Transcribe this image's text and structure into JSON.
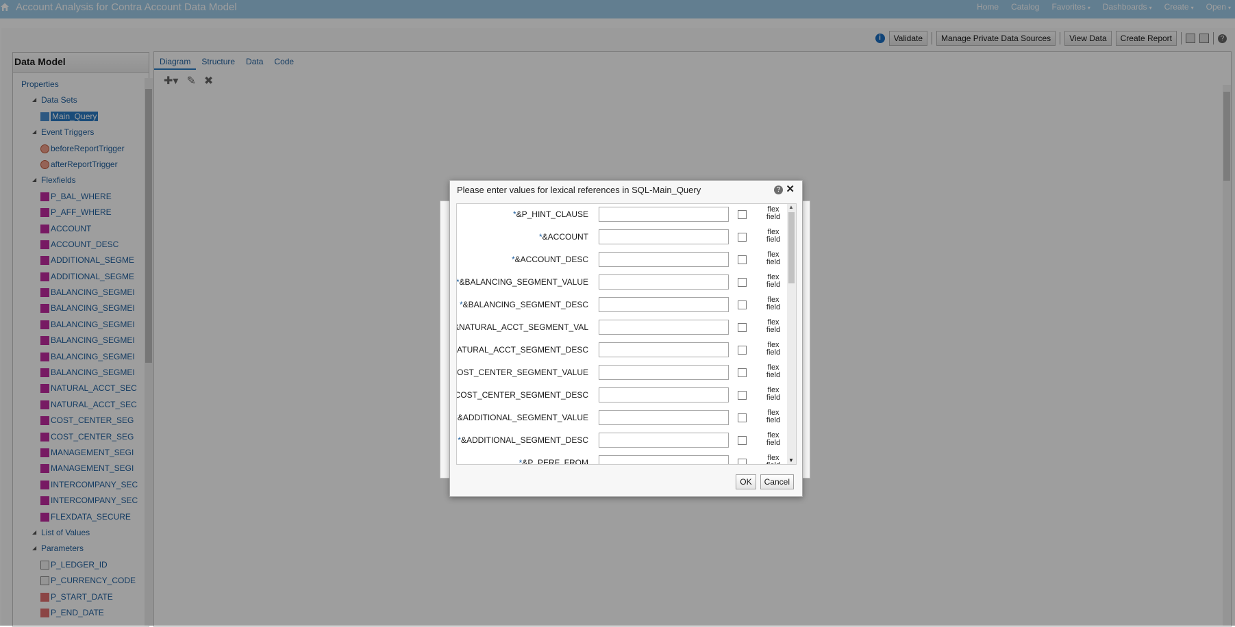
{
  "app": {
    "title": "Account Analysis for Contra Account Data Model",
    "nav": [
      {
        "label": "Home",
        "caret": false
      },
      {
        "label": "Catalog",
        "caret": false
      },
      {
        "label": "Favorites",
        "caret": true
      },
      {
        "label": "Dashboards",
        "caret": true
      },
      {
        "label": "Create",
        "caret": true
      },
      {
        "label": "Open",
        "caret": true
      }
    ]
  },
  "toolbar": {
    "validate": "Validate",
    "manage_sources": "Manage Private Data Sources",
    "view_data": "View Data",
    "create_report": "Create Report"
  },
  "data_model": {
    "header": "Data Model",
    "tree": [
      {
        "label": "Properties",
        "level": 0,
        "icon": "",
        "arrow": false,
        "selected": false
      },
      {
        "label": "Data Sets",
        "level": 1,
        "icon": "",
        "arrow": true,
        "selected": false
      },
      {
        "label": "Main_Query",
        "level": 2,
        "icon": "dataset-icon",
        "arrow": false,
        "selected": true
      },
      {
        "label": "Event Triggers",
        "level": 1,
        "icon": "",
        "arrow": true,
        "selected": false
      },
      {
        "label": "beforeReportTrigger",
        "level": 2,
        "icon": "trigger-icon",
        "arrow": false,
        "selected": false
      },
      {
        "label": "afterReportTrigger",
        "level": 2,
        "icon": "trigger-icon",
        "arrow": false,
        "selected": false
      },
      {
        "label": "Flexfields",
        "level": 1,
        "icon": "",
        "arrow": true,
        "selected": false
      },
      {
        "label": "P_BAL_WHERE",
        "level": 2,
        "icon": "flexfield-icon",
        "arrow": false,
        "selected": false
      },
      {
        "label": "P_AFF_WHERE",
        "level": 2,
        "icon": "flexfield-icon",
        "arrow": false,
        "selected": false
      },
      {
        "label": "ACCOUNT",
        "level": 2,
        "icon": "flexfield-icon",
        "arrow": false,
        "selected": false
      },
      {
        "label": "ACCOUNT_DESC",
        "level": 2,
        "icon": "flexfield-icon",
        "arrow": false,
        "selected": false
      },
      {
        "label": "ADDITIONAL_SEGME",
        "level": 2,
        "icon": "flexfield-icon",
        "arrow": false,
        "selected": false
      },
      {
        "label": "ADDITIONAL_SEGME",
        "level": 2,
        "icon": "flexfield-icon",
        "arrow": false,
        "selected": false
      },
      {
        "label": "BALANCING_SEGMEI",
        "level": 2,
        "icon": "flexfield-icon",
        "arrow": false,
        "selected": false
      },
      {
        "label": "BALANCING_SEGMEI",
        "level": 2,
        "icon": "flexfield-icon",
        "arrow": false,
        "selected": false
      },
      {
        "label": "BALANCING_SEGMEI",
        "level": 2,
        "icon": "flexfield-icon",
        "arrow": false,
        "selected": false
      },
      {
        "label": "BALANCING_SEGMEI",
        "level": 2,
        "icon": "flexfield-icon",
        "arrow": false,
        "selected": false
      },
      {
        "label": "BALANCING_SEGMEI",
        "level": 2,
        "icon": "flexfield-icon",
        "arrow": false,
        "selected": false
      },
      {
        "label": "BALANCING_SEGMEI",
        "level": 2,
        "icon": "flexfield-icon",
        "arrow": false,
        "selected": false
      },
      {
        "label": "NATURAL_ACCT_SEC",
        "level": 2,
        "icon": "flexfield-icon",
        "arrow": false,
        "selected": false
      },
      {
        "label": "NATURAL_ACCT_SEC",
        "level": 2,
        "icon": "flexfield-icon",
        "arrow": false,
        "selected": false
      },
      {
        "label": "COST_CENTER_SEG",
        "level": 2,
        "icon": "flexfield-icon",
        "arrow": false,
        "selected": false
      },
      {
        "label": "COST_CENTER_SEG",
        "level": 2,
        "icon": "flexfield-icon",
        "arrow": false,
        "selected": false
      },
      {
        "label": "MANAGEMENT_SEGI",
        "level": 2,
        "icon": "flexfield-icon",
        "arrow": false,
        "selected": false
      },
      {
        "label": "MANAGEMENT_SEGI",
        "level": 2,
        "icon": "flexfield-icon",
        "arrow": false,
        "selected": false
      },
      {
        "label": "INTERCOMPANY_SEC",
        "level": 2,
        "icon": "flexfield-icon",
        "arrow": false,
        "selected": false
      },
      {
        "label": "INTERCOMPANY_SEC",
        "level": 2,
        "icon": "flexfield-icon",
        "arrow": false,
        "selected": false
      },
      {
        "label": "FLEXDATA_SECURE",
        "level": 2,
        "icon": "flexfield-icon",
        "arrow": false,
        "selected": false
      },
      {
        "label": "List of Values",
        "level": 1,
        "icon": "",
        "arrow": true,
        "selected": false
      },
      {
        "label": "Parameters",
        "level": 1,
        "icon": "",
        "arrow": true,
        "selected": false
      },
      {
        "label": "P_LEDGER_ID",
        "level": 2,
        "icon": "parameter-icon",
        "arrow": false,
        "selected": false
      },
      {
        "label": "P_CURRENCY_CODE",
        "level": 2,
        "icon": "parameter-icon",
        "arrow": false,
        "selected": false
      },
      {
        "label": "P_START_DATE",
        "level": 2,
        "icon": "date-parameter-icon",
        "arrow": false,
        "selected": false
      },
      {
        "label": "P_END_DATE",
        "level": 2,
        "icon": "date-parameter-icon",
        "arrow": false,
        "selected": false
      }
    ]
  },
  "tabs": [
    {
      "label": "Diagram",
      "active": true
    },
    {
      "label": "Structure",
      "active": false
    },
    {
      "label": "Data",
      "active": false
    },
    {
      "label": "Code",
      "active": false
    }
  ],
  "dialog": {
    "title": "Please enter values for lexical references in SQL-Main_Query",
    "flex_label_line1": "flex",
    "flex_label_line2": "field",
    "params": [
      {
        "label": "&P_HINT_CLAUSE",
        "value": ""
      },
      {
        "label": "&ACCOUNT",
        "value": ""
      },
      {
        "label": "&ACCOUNT_DESC",
        "value": ""
      },
      {
        "label": "&BALANCING_SEGMENT_VALUE",
        "value": ""
      },
      {
        "label": "&BALANCING_SEGMENT_DESC",
        "value": ""
      },
      {
        "label": "&NATURAL_ACCT_SEGMENT_VAL",
        "value": ""
      },
      {
        "label": "&NATURAL_ACCT_SEGMENT_DESC",
        "value": ""
      },
      {
        "label": "&COST_CENTER_SEGMENT_VALUE",
        "value": ""
      },
      {
        "label": "&COST_CENTER_SEGMENT_DESC",
        "value": ""
      },
      {
        "label": "&ADDITIONAL_SEGMENT_VALUE",
        "value": ""
      },
      {
        "label": "&ADDITIONAL_SEGMENT_DESC",
        "value": ""
      },
      {
        "label": "&P_PERF_FROM",
        "value": ""
      }
    ],
    "ok": "OK",
    "cancel": "Cancel"
  }
}
